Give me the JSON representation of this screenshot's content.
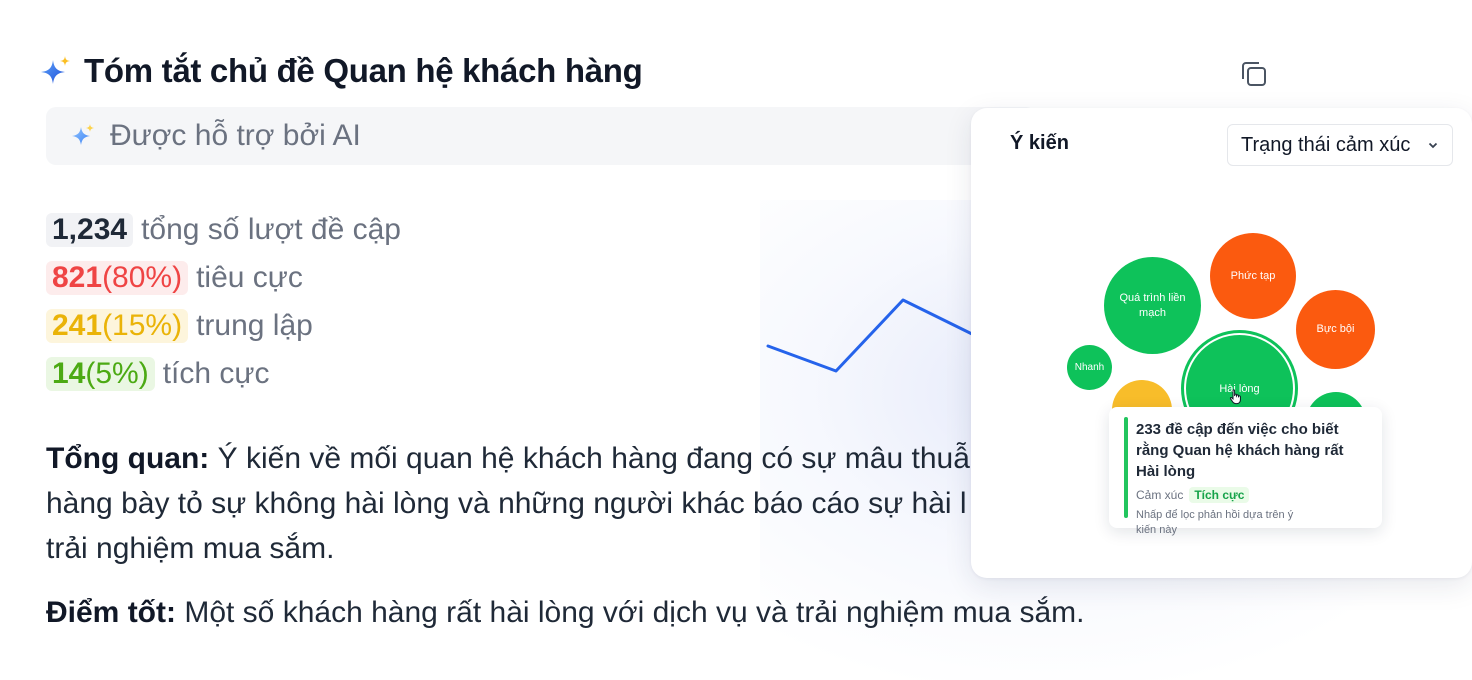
{
  "header": {
    "title": "Tóm tắt chủ đề Quan hệ khách hàng",
    "ai_label": "Được hỗ trợ bởi AI"
  },
  "stats": {
    "total": {
      "value": "1,234",
      "label": "tổng số lượt đề cập"
    },
    "negative": {
      "value": "821",
      "percent": "(80%)",
      "label": "tiêu cực"
    },
    "neutral": {
      "value": "241",
      "percent": "(15%)",
      "label": "trung lập"
    },
    "positive": {
      "value": "14",
      "percent": "(5%)",
      "label": "tích cực"
    }
  },
  "overview": {
    "heading": "Tổng quan:",
    "text": " Ý kiến về mối quan hệ khách hàng đang có sự mâu thuẫ hàng bày tỏ sự không hài lòng và những người khác báo cáo sự hài l trải nghiệm mua sắm."
  },
  "strengths": {
    "heading": "Điểm tốt:",
    "text": " Một số khách hàng rất hài lòng với dịch vụ và trải nghiệm mua sắm."
  },
  "opinion_card": {
    "label": "Ý kiến",
    "select_value": "Trạng thái cảm xúc",
    "bubbles": [
      {
        "label": "Quá trình liền mạch",
        "sentiment": "positive"
      },
      {
        "label": "Phức tạp",
        "sentiment": "negative"
      },
      {
        "label": "Bực bội",
        "sentiment": "negative"
      },
      {
        "label": "Nhanh",
        "sentiment": "positive"
      },
      {
        "label": "Hài lòng",
        "sentiment": "positive"
      },
      {
        "label": "",
        "sentiment": "neutral"
      },
      {
        "label": "",
        "sentiment": "positive"
      }
    ],
    "tooltip": {
      "headline": "233 đề cập đến việc cho biết rằng Quan hệ khách hàng rất Hài lòng",
      "sentiment_label": "Cảm xúc",
      "sentiment_value": "Tích cực",
      "hint": "Nhấp để lọc phản hồi dựa trên ý kiến này"
    }
  },
  "colors": {
    "negative": "#ef4444",
    "neutral": "#eab308",
    "positive": "#4caa14",
    "bubble_green": "#0ec25a",
    "bubble_red": "#fb5a0f",
    "bubble_yellow": "#f8bd2a",
    "line": "#2563eb"
  },
  "icons": {
    "title_icon": "sparkles-icon",
    "ai_icon": "sparkles-icon",
    "copy": "copy-icon",
    "select": "chevron-down-icon",
    "cursor": "hand-pointer-icon"
  }
}
